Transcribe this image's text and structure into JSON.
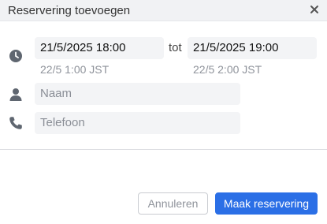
{
  "dialog": {
    "title": "Reservering toevoegen",
    "close_icon": "close-icon"
  },
  "time": {
    "icon": "clock-icon",
    "start_value": "21/5/2025  18:00",
    "start_sub": "22/5 1:00 JST",
    "separator": "tot",
    "end_value": "21/5/2025  19:00",
    "end_sub": "22/5 2:00 JST"
  },
  "name": {
    "icon": "user-icon",
    "placeholder": "Naam"
  },
  "phone": {
    "icon": "phone-icon",
    "placeholder": "Telefoon"
  },
  "footer": {
    "cancel_label": "Annuleren",
    "submit_label": "Maak reservering"
  },
  "colors": {
    "primary": "#2b6fe6",
    "icon": "#5f6670",
    "field_bg": "#f3f4f6"
  }
}
